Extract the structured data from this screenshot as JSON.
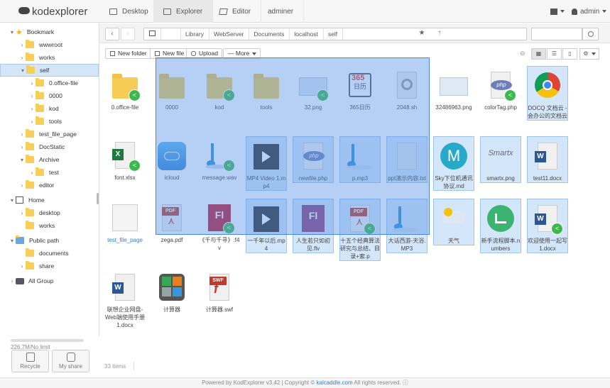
{
  "app": {
    "logo": "kodexplorer"
  },
  "topnav": [
    {
      "label": "Desktop",
      "icon": "monitor-icon"
    },
    {
      "label": "Explorer",
      "icon": "explorer-icon"
    },
    {
      "label": "Editor",
      "icon": "edit-icon"
    },
    {
      "label": "adminer",
      "icon": ""
    }
  ],
  "topright": {
    "flag_icon": "flag-icon",
    "user": "admin",
    "user_icon": "user-icon"
  },
  "tree": [
    {
      "label": "Bookmark",
      "icon": "star-icon",
      "arrow": "▾"
    },
    {
      "label": "wwwroot",
      "arrow": "›"
    },
    {
      "label": "works",
      "arrow": "›"
    },
    {
      "label": "self",
      "arrow": "▾"
    },
    {
      "label": "0.office-file",
      "arrow": "›"
    },
    {
      "label": "0000",
      "arrow": "›"
    },
    {
      "label": "kod",
      "arrow": "›"
    },
    {
      "label": "tools",
      "arrow": "›"
    },
    {
      "label": "test_file_page",
      "arrow": "›"
    },
    {
      "label": "DocStatic",
      "arrow": "›"
    },
    {
      "label": "Archive",
      "arrow": "▾"
    },
    {
      "label": "test",
      "arrow": "›"
    },
    {
      "label": "editor",
      "arrow": "›"
    },
    {
      "label": "Home",
      "icon": "home-icon",
      "arrow": "▾"
    },
    {
      "label": "desktop",
      "arrow": "›"
    },
    {
      "label": "works",
      "arrow": ""
    },
    {
      "label": "Public path",
      "icon": "public-icon",
      "arrow": "▾"
    },
    {
      "label": "documents",
      "arrow": ""
    },
    {
      "label": "share",
      "arrow": "›"
    },
    {
      "label": "All Group",
      "icon": "group-icon",
      "arrow": "›"
    }
  ],
  "quota": {
    "text": "226.7M/No limit",
    "used_fraction": 0.01
  },
  "bottom_buttons": [
    {
      "label": "Recycle",
      "icon": "trash-icon"
    },
    {
      "label": "My share",
      "icon": "share-icon"
    }
  ],
  "path": {
    "crumbs": [
      "Library",
      "WebServer",
      "Documents",
      "localhost",
      "self"
    ],
    "search_placeholder": ""
  },
  "toolbar": {
    "new_folder": "New folder",
    "new_file": "New file",
    "upload": "Upload",
    "more": "More"
  },
  "items": [
    {
      "name": "0.office-file",
      "type": "folder",
      "share": true
    },
    {
      "name": "0000",
      "type": "folder",
      "share": false
    },
    {
      "name": "kod",
      "type": "folder",
      "share": true
    },
    {
      "name": "tools",
      "type": "folder",
      "share": false
    },
    {
      "name": "32.png",
      "type": "image",
      "share": true
    },
    {
      "name": "365日历",
      "type": "app365",
      "share": false
    },
    {
      "name": "2048.sh",
      "type": "gear",
      "share": false
    },
    {
      "name": "32486963.png",
      "type": "image",
      "share": false
    },
    {
      "name": "colorTag.php",
      "type": "php",
      "share": true
    },
    {
      "name": "DOCQ 文档云 - 会办公的文档云",
      "type": "chrome",
      "share": false,
      "sel": true
    },
    {
      "name": "font.xlsx",
      "type": "xlsx",
      "share": true
    },
    {
      "name": "icloud",
      "type": "icloud",
      "share": false
    },
    {
      "name": "message.wav",
      "type": "music",
      "share": true
    },
    {
      "name": "MP4 Video 1.mp4",
      "type": "video",
      "share": false,
      "sel": true
    },
    {
      "name": "newfile.php",
      "type": "php",
      "share": false,
      "sel": true
    },
    {
      "name": "p.mp3",
      "type": "music",
      "share": false,
      "sel": true
    },
    {
      "name": "ppt演示内容.txt",
      "type": "txt",
      "share": false,
      "sel": true
    },
    {
      "name": "Sky下位机通讯协议.md",
      "type": "md",
      "share": false,
      "sel": true
    },
    {
      "name": "smartx.png",
      "type": "smartx",
      "share": false,
      "sel": true
    },
    {
      "name": "test11.docx",
      "type": "docx",
      "share": false,
      "sel": true
    },
    {
      "name": "test_file_page",
      "type": "blank",
      "share": false,
      "link": true
    },
    {
      "name": "zega.pdf",
      "type": "pdf",
      "share": false
    },
    {
      "name": "《千与千寻》.f4v",
      "type": "flv",
      "share": true
    },
    {
      "name": "一千年以后.mp4",
      "type": "video",
      "share": false,
      "sel": true
    },
    {
      "name": "人生若只如初见.flv",
      "type": "flv2",
      "share": false,
      "sel": true
    },
    {
      "name": "十五个经典算法研究与总结、目录+索.p",
      "type": "pdf",
      "share": true,
      "sel": true
    },
    {
      "name": "大话西游-天浴.MP3",
      "type": "music",
      "share": false,
      "sel": true
    },
    {
      "name": "天气",
      "type": "weather",
      "share": false,
      "sel": true
    },
    {
      "name": "新手流程脚本.numbers",
      "type": "numbers",
      "share": false,
      "sel": true
    },
    {
      "name": "欢迎使用一起写1.docx",
      "type": "docx",
      "share": true,
      "sel": true
    },
    {
      "name": "联想企业网盘-Web端使用手册1.docx",
      "type": "docx",
      "share": false
    },
    {
      "name": "计算器",
      "type": "calc",
      "share": false
    },
    {
      "name": "计算器.swf",
      "type": "swf",
      "share": false
    }
  ],
  "count": "33 items",
  "footer": {
    "prefix": "Powered by KodExplorer v3.42 | Copyright ©",
    "link": "kalcaddle.com",
    "suffix": "All rights reserved."
  },
  "colors": {
    "folder": "#f6cc57",
    "share": "#3db84e",
    "selection": "#5a96e6",
    "link": "#3a7cc6"
  }
}
